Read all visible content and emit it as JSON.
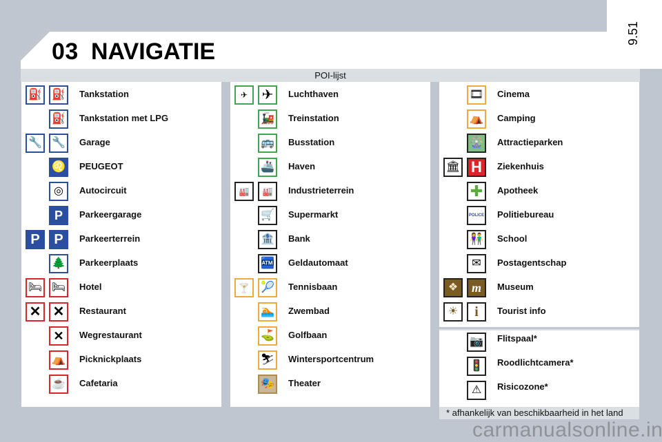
{
  "header": {
    "chapter": "03",
    "title": "NAVIGATIE",
    "page_number": "9.51",
    "subtitle": "POI-lijst"
  },
  "columns": [
    {
      "items": [
        {
          "label": "Tankstation",
          "icons": [
            "fuel-pump-icon",
            "fuel-pump-icon"
          ],
          "color": "#2b4ea0"
        },
        {
          "label": "Tankstation met LPG",
          "icons": [
            "lpg-fuel-pump-icon"
          ],
          "color": "#2b4ea0"
        },
        {
          "label": "Garage",
          "icons": [
            "wrench-icon",
            "wrench-icon"
          ],
          "color": "#2b4ea0"
        },
        {
          "label": "PEUGEOT",
          "icons": [
            "peugeot-lion-icon"
          ],
          "color": "#2b4ea0"
        },
        {
          "label": "Autocircuit",
          "icons": [
            "race-circuit-icon"
          ],
          "color": "#2b4ea0"
        },
        {
          "label": "Parkeergarage",
          "icons": [
            "parking-garage-icon"
          ],
          "color": "#2b4ea0"
        },
        {
          "label": "Parkeerterrein",
          "icons": [
            "parking-icon",
            "parking-icon"
          ],
          "color": "#2b4ea0"
        },
        {
          "label": "Parkeerplaats",
          "icons": [
            "rest-area-icon"
          ],
          "color": "#2b4ea0"
        },
        {
          "label": "Hotel",
          "icons": [
            "bed-icon",
            "bed-icon"
          ],
          "color": "#d8262b"
        },
        {
          "label": "Restaurant",
          "icons": [
            "cutlery-icon",
            "cutlery-icon"
          ],
          "color": "#d8262b"
        },
        {
          "label": "Wegrestaurant",
          "icons": [
            "roadside-restaurant-icon"
          ],
          "color": "#d8262b"
        },
        {
          "label": "Picknickplaats",
          "icons": [
            "picnic-icon"
          ],
          "color": "#d8262b"
        },
        {
          "label": "Cafetaria",
          "icons": [
            "coffee-cup-icon"
          ],
          "color": "#d8262b"
        }
      ]
    },
    {
      "items": [
        {
          "label": "Luchthaven",
          "icons": [
            "transport-group-icon",
            "airplane-icon"
          ],
          "color": "#3fa64a"
        },
        {
          "label": "Treinstation",
          "icons": [
            "train-icon"
          ],
          "color": "#3fa64a"
        },
        {
          "label": "Busstation",
          "icons": [
            "bus-icon"
          ],
          "color": "#3fa64a"
        },
        {
          "label": "Haven",
          "icons": [
            "ship-icon"
          ],
          "color": "#3fa64a"
        },
        {
          "label": "Industrieterrein",
          "icons": [
            "industry-group-icon",
            "industry-group-icon"
          ],
          "color": "#222222"
        },
        {
          "label": "Supermarkt",
          "icons": [
            "shopping-cart-icon"
          ],
          "color": "#222222"
        },
        {
          "label": "Bank",
          "icons": [
            "bank-icon"
          ],
          "color": "#222222"
        },
        {
          "label": "Geldautomaat",
          "icons": [
            "atm-icon"
          ],
          "color": "#222222"
        },
        {
          "label": "Tennisbaan",
          "icons": [
            "leisure-sport-icon",
            "tennis-icon"
          ],
          "color": "#f0a93a"
        },
        {
          "label": "Zwembad",
          "icons": [
            "swimmer-icon"
          ],
          "color": "#f0a93a"
        },
        {
          "label": "Golfbaan",
          "icons": [
            "golfer-icon"
          ],
          "color": "#f0a93a"
        },
        {
          "label": "Wintersportcentrum",
          "icons": [
            "skier-icon"
          ],
          "color": "#f0a93a"
        },
        {
          "label": "Theater",
          "icons": [
            "theater-icon"
          ],
          "color": "#b08a4a"
        }
      ]
    },
    {
      "items": [
        {
          "label": "Cinema",
          "icons": [
            "film-reel-icon"
          ],
          "color": "#f0a93a"
        },
        {
          "label": "Camping",
          "icons": [
            "camping-icon"
          ],
          "color": "#f0a93a"
        },
        {
          "label": "Attractieparken",
          "icons": [
            "ferris-wheel-icon"
          ],
          "color": "#3fa64a"
        },
        {
          "label": "Ziekenhuis",
          "icons": [
            "public-building-icon",
            "hospital-icon"
          ],
          "color": "#d8262b"
        },
        {
          "label": "Apotheek",
          "icons": [
            "pharmacy-cross-icon"
          ],
          "color": "#3fa64a"
        },
        {
          "label": "Politiebureau",
          "icons": [
            "police-icon"
          ],
          "color": "#2b4ea0"
        },
        {
          "label": "School",
          "icons": [
            "children-icon"
          ],
          "color": "#222222"
        },
        {
          "label": "Postagentschap",
          "icons": [
            "envelope-icon"
          ],
          "color": "#222222"
        },
        {
          "label": "Museum",
          "icons": [
            "monument-icon",
            "museum-m-icon"
          ],
          "color": "#7a5b24"
        },
        {
          "label": "Tourist info",
          "icons": [
            "sun-rays-icon",
            "info-icon"
          ],
          "color": "#7a5b24"
        }
      ],
      "alerts": [
        {
          "label": "Flitspaal*",
          "icons": [
            "speed-camera-icon"
          ]
        },
        {
          "label": "Roodlichtcamera*",
          "icons": [
            "red-light-camera-icon"
          ]
        },
        {
          "label": "Risicozone*",
          "icons": [
            "warning-triangle-icon"
          ]
        }
      ]
    }
  ],
  "glyphs": {
    "fuel": "⛽",
    "lpg": "⛽",
    "wrench": "🔧",
    "lion": "♌",
    "circuit": "◎",
    "pgarage": "P",
    "parking": "P",
    "rest": "🌲",
    "bed": "🛏",
    "cutlery": "✕",
    "roadrest": "✕",
    "picnic": "⛺",
    "coffee": "☕",
    "transport": "✈",
    "plane": "✈",
    "train": "🚂",
    "bus": "🚌",
    "ship": "🚢",
    "industry": "🏭",
    "cart": "🛒",
    "bank": "🏦",
    "atm": "🏧",
    "sport": "🍸",
    "tennis": "🎾",
    "swim": "🏊",
    "golf": "⛳",
    "ski": "⛷",
    "theater": "🎭",
    "film": "🎞",
    "camping": "⛺",
    "ferris": "🎡",
    "building": "🏛",
    "hospital": "H",
    "cross": "✚",
    "police": "POLICE",
    "children": "👫",
    "envelope": "✉",
    "monument": "❖",
    "museum": "m",
    "sun": "☀",
    "info": "i",
    "speedcam": "📷",
    "redcam": "🚦",
    "warning": "⚠"
  },
  "footnote": "* afhankelijk van beschikbaarheid in het land",
  "watermark": "carmanualsonline.info"
}
